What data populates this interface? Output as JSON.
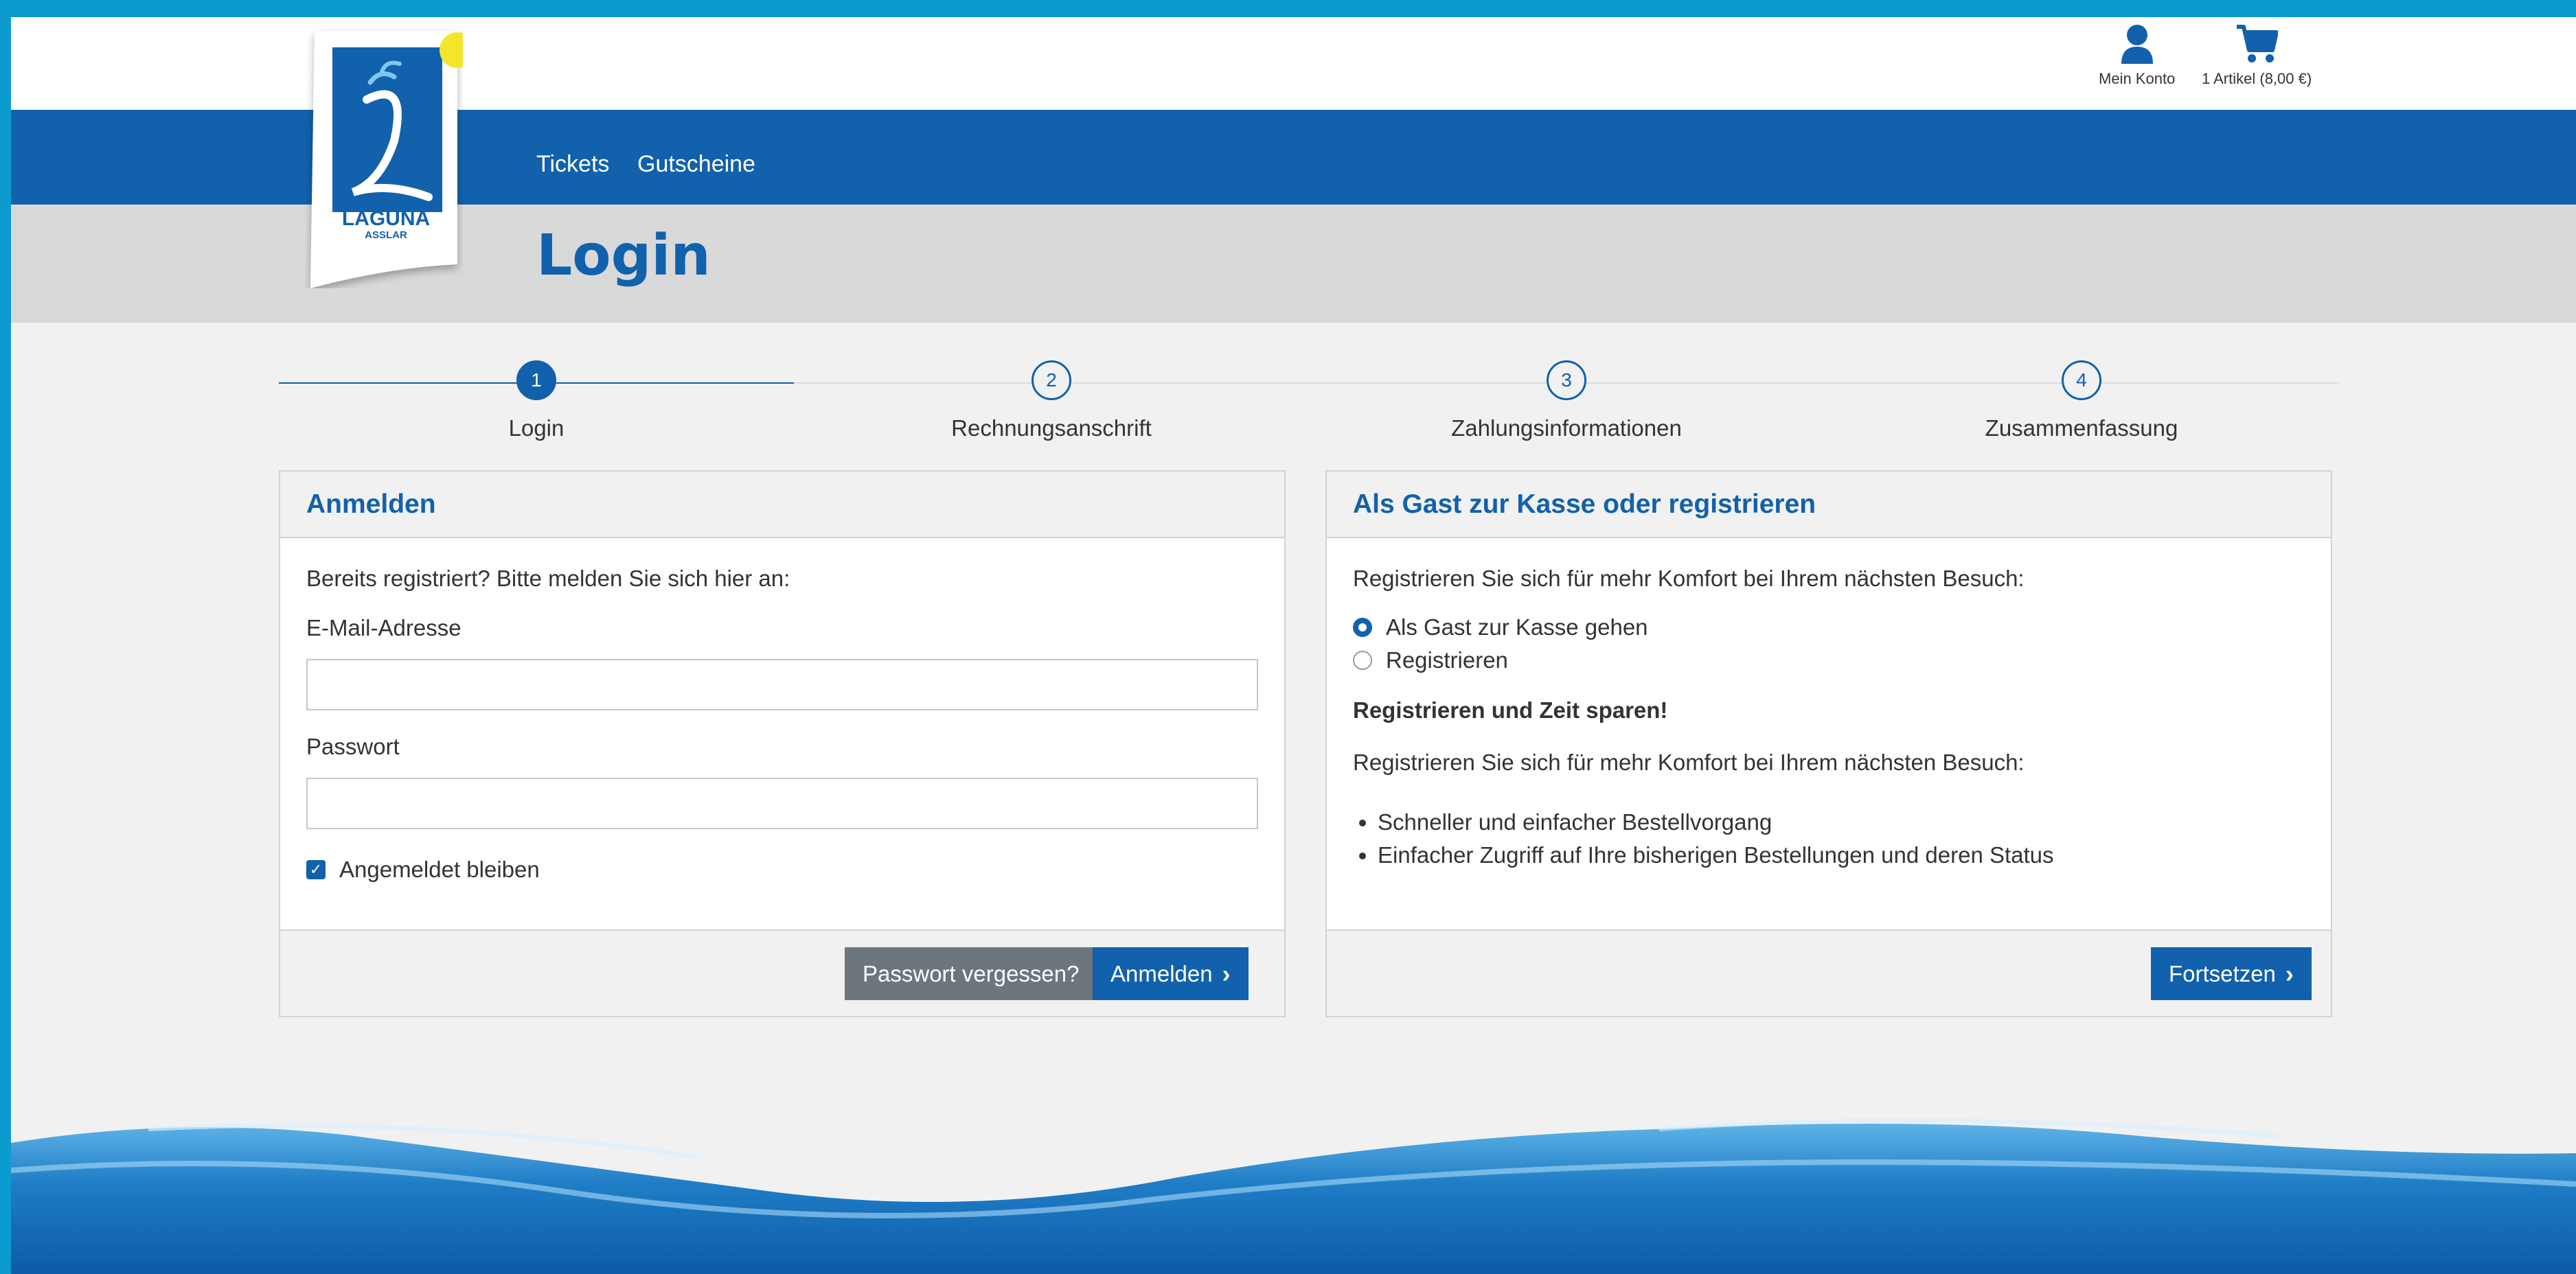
{
  "header": {
    "logo_text": "LAGUNA",
    "logo_subtext": "ASSLAR",
    "account_label": "Mein Konto",
    "cart_label": "1 Artikel (8,00 €)"
  },
  "nav": {
    "items": [
      {
        "label": "Tickets"
      },
      {
        "label": "Gutscheine"
      }
    ]
  },
  "page_title": "Login",
  "stepper": {
    "steps": [
      {
        "num": "1",
        "label": "Login",
        "active": true
      },
      {
        "num": "2",
        "label": "Rechnungsanschrift",
        "active": false
      },
      {
        "num": "3",
        "label": "Zahlungsinformationen",
        "active": false
      },
      {
        "num": "4",
        "label": "Zusammenfassung",
        "active": false
      }
    ]
  },
  "login_panel": {
    "title": "Anmelden",
    "intro": "Bereits registriert? Bitte melden Sie sich hier an:",
    "email_label": "E-Mail-Adresse",
    "email_value": "",
    "password_label": "Passwort",
    "password_value": "",
    "remember_label": "Angemeldet bleiben",
    "remember_checked": true,
    "forgot_button": "Passwort vergessen?",
    "login_button": "Anmelden"
  },
  "guest_panel": {
    "title": "Als Gast zur Kasse oder registrieren",
    "intro": "Registrieren Sie sich für mehr Komfort bei Ihrem nächsten Besuch:",
    "options": [
      {
        "label": "Als Gast zur Kasse gehen",
        "checked": true
      },
      {
        "label": "Registrieren",
        "checked": false
      }
    ],
    "save_time_heading": "Registrieren und Zeit sparen!",
    "save_time_text": "Registrieren Sie sich für mehr Komfort bei Ihrem nächsten Besuch:",
    "features": [
      "Schneller und einfacher Bestellvorgang",
      "Einfacher Zugriff auf Ihre bisherigen Bestellungen und deren Status"
    ],
    "continue_button": "Fortsetzen"
  },
  "colors": {
    "brand_blue": "#1161ac",
    "frame_cyan": "#0b9bcf",
    "logo_yellow": "#f3e52a"
  },
  "icons": {
    "account": "person-icon",
    "cart": "cart-icon",
    "chevron": "chevron-right-icon"
  }
}
